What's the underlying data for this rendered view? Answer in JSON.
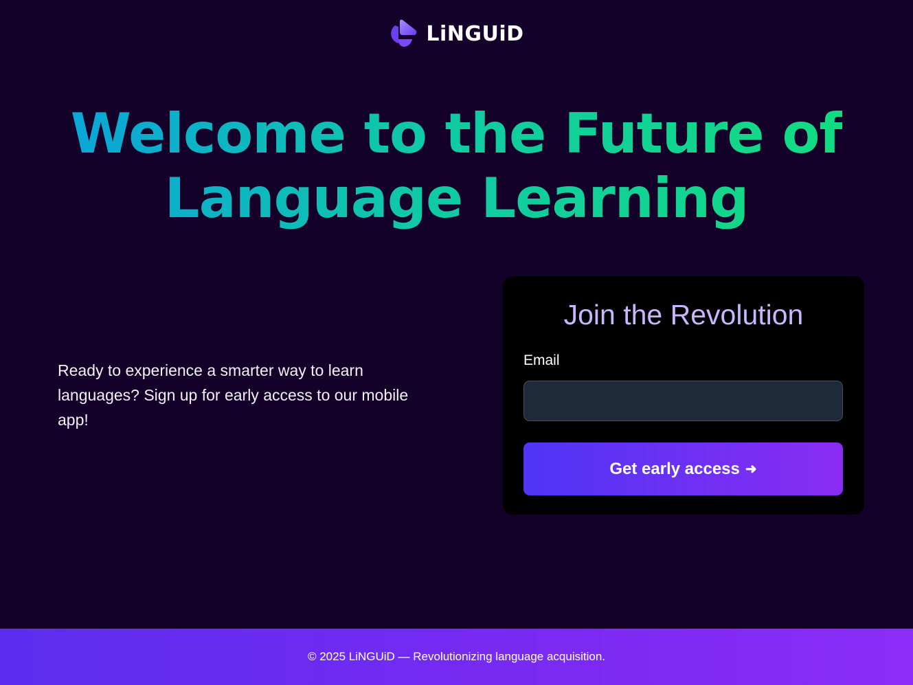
{
  "brand": {
    "name": "LiNGUiD",
    "logo_icon": "linguid-logo-icon",
    "accent_color": "#7c4dff"
  },
  "hero": {
    "line1": "Welcome to the Future of",
    "line2": "Language Learning",
    "gradient_colors": [
      "#0aa6d8",
      "#12dc82"
    ]
  },
  "intro": {
    "text": "Ready to experience a smarter way to learn languages? Sign up for early access to our mobile app!"
  },
  "signup": {
    "title": "Join the Revolution",
    "email_label": "Email",
    "email_value": "",
    "email_placeholder": "",
    "button_label": "Get early access",
    "button_icon": "arrow-right-icon",
    "button_arrow": "➜"
  },
  "footer": {
    "text": "© 2025 LiNGUiD — Revolutionizing language acquisition."
  }
}
